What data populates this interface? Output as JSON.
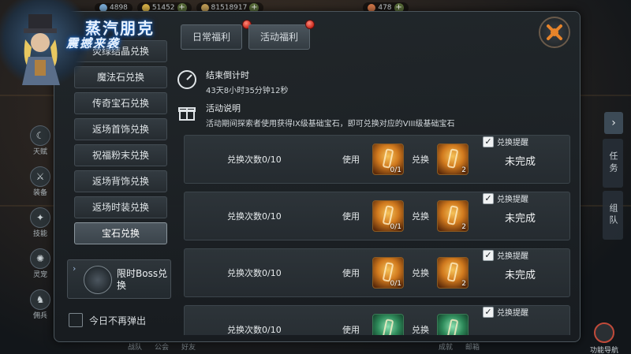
{
  "banner": {
    "title": "蒸汽朋克",
    "subtitle": "震撼来袭"
  },
  "topbar": {
    "res1": "4898",
    "res2": "51452",
    "res3": "81518917",
    "res4": "478"
  },
  "left_menu": [
    {
      "label": "天赋",
      "icon": "talent-icon"
    },
    {
      "label": "装备",
      "icon": "equipment-icon"
    },
    {
      "label": "技能",
      "icon": "skill-icon"
    },
    {
      "label": "灵宠",
      "icon": "pet-icon"
    },
    {
      "label": "佣兵",
      "icon": "mercenary-icon"
    }
  ],
  "right_side": {
    "task": "任务",
    "team": "组队",
    "nav": "功能导航",
    "open": "开"
  },
  "bottom_bar": {
    "guild": "战队",
    "union": "公会",
    "friends": "好友",
    "achievement": "成就",
    "mail": "邮箱"
  },
  "tabs": {
    "daily": "日常福利",
    "event": "活动福利"
  },
  "sidebar": {
    "items": [
      "荧绿结晶兑换",
      "魔法石兑换",
      "传奇宝石兑换",
      "返场首饰兑换",
      "祝福粉末兑换",
      "返场背饰兑换",
      "返场时装兑换",
      "宝石兑换"
    ],
    "active_index": 7,
    "boss_label": "限时Boss兑换",
    "no_popup": "今日不再弹出"
  },
  "info": {
    "countdown_title": "结束倒计时",
    "countdown_value": "43天8小时35分钟12秒",
    "desc_title": "活动说明",
    "desc_text": "活动期间探索者使用获得IX级基础宝石，即可兑换对应的VIII级基础宝石"
  },
  "exchange": {
    "rows": [
      {
        "count": "兑换次数0/10",
        "use": "使用",
        "exchange": "兑换",
        "use_qty": "0/1",
        "out_qty": "2",
        "remind": "兑换提醒",
        "status": "未完成",
        "color": "orange"
      },
      {
        "count": "兑换次数0/10",
        "use": "使用",
        "exchange": "兑换",
        "use_qty": "0/1",
        "out_qty": "2",
        "remind": "兑换提醒",
        "status": "未完成",
        "color": "orange"
      },
      {
        "count": "兑换次数0/10",
        "use": "使用",
        "exchange": "兑换",
        "use_qty": "0/1",
        "out_qty": "2",
        "remind": "兑换提醒",
        "status": "未完成",
        "color": "orange"
      },
      {
        "count": "兑换次数0/10",
        "use": "使用",
        "exchange": "兑换",
        "use_qty": "",
        "out_qty": "",
        "remind": "兑换提醒",
        "status": "",
        "color": "green"
      }
    ]
  },
  "colors": {
    "accent_red": "#c8261a",
    "panel_bg": "#20262a",
    "gem_orange": "#d17a1e",
    "gem_green": "#2e8a5a"
  }
}
